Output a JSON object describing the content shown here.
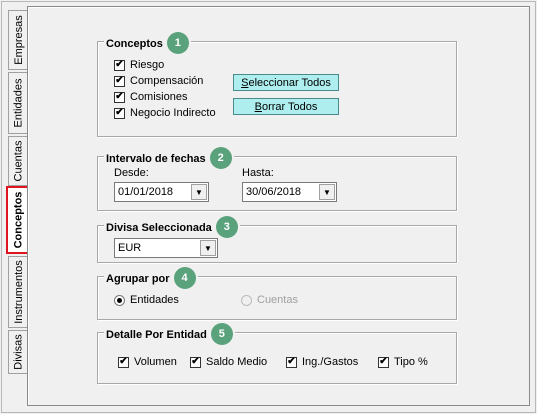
{
  "tabs": [
    {
      "label": "Empresas",
      "active": false
    },
    {
      "label": "Entidades",
      "active": false
    },
    {
      "label": "Cuentas",
      "active": false
    },
    {
      "label": "Conceptos",
      "active": true
    },
    {
      "label": "Instrumentos",
      "active": false
    },
    {
      "label": "Divisas",
      "active": false
    }
  ],
  "conceptos": {
    "title": "Conceptos",
    "badge": "1",
    "items": [
      {
        "label": "Riesgo",
        "checked": true
      },
      {
        "label": "Compensación",
        "checked": true
      },
      {
        "label": "Comisiones",
        "checked": true
      },
      {
        "label": "Negocio Indirecto",
        "checked": true
      }
    ],
    "select_all_label_pre": "",
    "select_all_key": "S",
    "select_all_label_post": "eleccionar Todos",
    "clear_all_label_pre": "",
    "clear_all_key": "B",
    "clear_all_label_post": "orrar Todos"
  },
  "intervalo": {
    "title": "Intervalo de fechas",
    "badge": "2",
    "from_label": "Desde:",
    "from_value": "01/01/2018",
    "to_label": "Hasta:",
    "to_value": "30/06/2018"
  },
  "divisa": {
    "title": "Divisa Seleccionada",
    "badge": "3",
    "value": "EUR"
  },
  "agrupar": {
    "title": "Agrupar por",
    "badge": "4",
    "options": [
      {
        "label": "Entidades",
        "selected": true,
        "enabled": true
      },
      {
        "label": "Cuentas",
        "selected": false,
        "enabled": false
      }
    ]
  },
  "detalle": {
    "title": "Detalle Por Entidad",
    "badge": "5",
    "items": [
      {
        "label": "Volumen",
        "checked": true
      },
      {
        "label": "Saldo Medio",
        "checked": true
      },
      {
        "label": "Ing./Gastos",
        "checked": true
      },
      {
        "label": "Tipo %",
        "checked": true
      }
    ]
  },
  "icons": {
    "check": "✔",
    "dropdown": "▼"
  }
}
